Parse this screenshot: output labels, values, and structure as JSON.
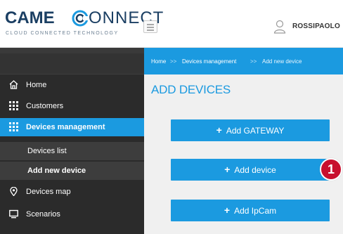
{
  "header": {
    "logo_came": "CAME",
    "logo_onnect": "ONNECT",
    "logo_tagline": "CLOUD CONNECTED TECHNOLOGY",
    "user_name": "ROSSIPAOLO"
  },
  "sidebar": {
    "items": [
      {
        "label": "Home",
        "icon": "home-icon"
      },
      {
        "label": "Customers",
        "icon": "grid-icon"
      },
      {
        "label": "Devices management",
        "icon": "grid-icon",
        "active": true
      },
      {
        "label": "Devices map",
        "icon": "map-pin-icon"
      },
      {
        "label": "Scenarios",
        "icon": "monitor-icon"
      }
    ],
    "subitems": [
      {
        "label": "Devices list"
      },
      {
        "label": "Add new device",
        "active": true
      }
    ]
  },
  "breadcrumb": {
    "home": "Home",
    "separator": ">>",
    "devices": "Devices management",
    "current": "Add new device"
  },
  "main": {
    "title": "ADD DEVICES",
    "buttons": [
      {
        "label": "Add GATEWAY"
      },
      {
        "label": "Add device"
      },
      {
        "label": "Add IpCam"
      }
    ],
    "callout": "1"
  },
  "colors": {
    "accent": "#1b9ae0",
    "sidebar_bg": "#2b2b2b",
    "callout": "#c8102e",
    "logo": "#1b3f63"
  }
}
